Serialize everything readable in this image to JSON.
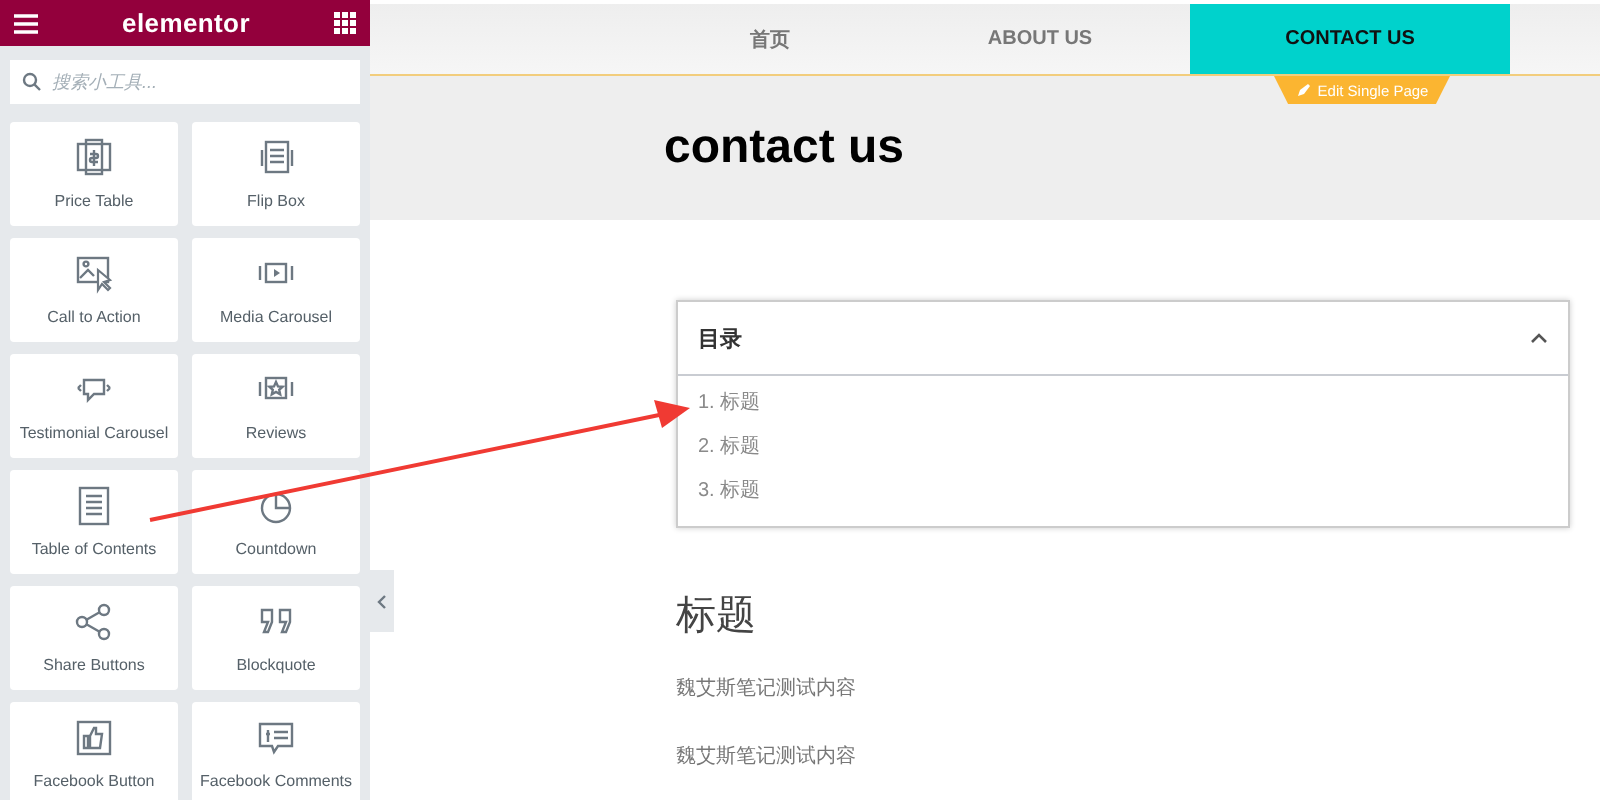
{
  "editor": {
    "logo": "elementor",
    "search": {
      "placeholder": "搜索小工具..."
    },
    "widgets": [
      {
        "label": "Price Table"
      },
      {
        "label": "Flip Box"
      },
      {
        "label": "Call to Action"
      },
      {
        "label": "Media Carousel"
      },
      {
        "label": "Testimonial Carousel"
      },
      {
        "label": "Reviews"
      },
      {
        "label": "Table of Contents"
      },
      {
        "label": "Countdown"
      },
      {
        "label": "Share Buttons"
      },
      {
        "label": "Blockquote"
      },
      {
        "label": "Facebook Button"
      },
      {
        "label": "Facebook Comments"
      }
    ]
  },
  "page": {
    "nav": [
      {
        "label": "首页",
        "selected": false
      },
      {
        "label": "ABOUT US",
        "selected": false
      },
      {
        "label": "CONTACT US",
        "selected": true
      }
    ],
    "edit_badge": "Edit Single Page",
    "title": "contact us",
    "toc": {
      "title": "目录",
      "expanded": true,
      "items": [
        {
          "number": "1.",
          "label": "标题"
        },
        {
          "number": "2.",
          "label": "标题"
        },
        {
          "number": "3.",
          "label": "标题"
        }
      ]
    },
    "heading": "标题",
    "paragraphs": [
      "魏艾斯笔记测试内容",
      "魏艾斯笔记测试内容"
    ]
  }
}
